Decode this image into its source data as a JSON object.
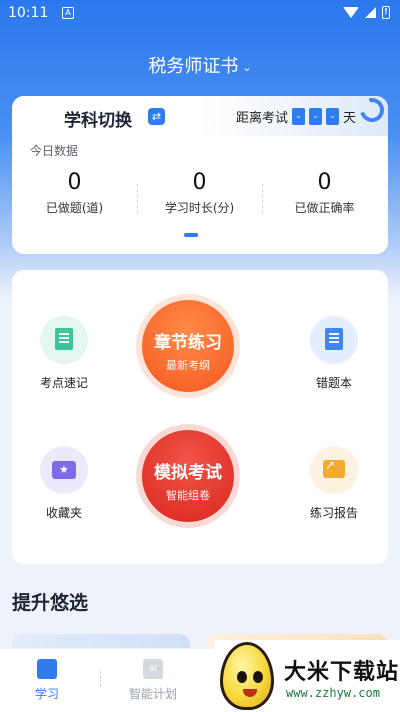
{
  "status_bar": {
    "time": "10:11",
    "app_icon_letter": "A",
    "battery_glyph": "!"
  },
  "header": {
    "title": "税务师证书",
    "dropdown_glyph": "⌄"
  },
  "data_card": {
    "subject_switch_label": "学科切换",
    "switch_glyph": "⇄",
    "countdown_prefix": "距离考试",
    "countdown_digits": [
      "-",
      "-",
      "-"
    ],
    "countdown_suffix": "天",
    "today_label": "今日数据",
    "stats": [
      {
        "value": "0",
        "label": "已做题(道)"
      },
      {
        "value": "0",
        "label": "学习时长(分)"
      },
      {
        "value": "0",
        "label": "已做正确率"
      }
    ]
  },
  "functions": {
    "key_notes": {
      "label": "考点速记",
      "icon": "book-icon",
      "color": "#3ec49a"
    },
    "wrong_book": {
      "label": "错题本",
      "icon": "notebook-icon",
      "color": "#3f86f0"
    },
    "favorites": {
      "label": "收藏夹",
      "icon": "folder-star-icon",
      "color": "#7c6be8"
    },
    "report": {
      "label": "练习报告",
      "icon": "chart-report-icon",
      "color": "#f4a931"
    },
    "chapter_practice": {
      "title": "章节练习",
      "subtitle": "最新考纲",
      "color": "#f8642e"
    },
    "mock_exam": {
      "title": "模拟考试",
      "subtitle": "智能组卷",
      "color": "#e2352b"
    }
  },
  "section": {
    "title": "提升悠选"
  },
  "tabbar": {
    "tabs": [
      {
        "label": "学习",
        "active": true,
        "color": "#2f7bf0"
      },
      {
        "label": "智能计划",
        "active": false,
        "color": "#9aa2b1"
      }
    ]
  },
  "watermark": {
    "title": "大米下载站",
    "url": "www.zzhyw.com"
  }
}
